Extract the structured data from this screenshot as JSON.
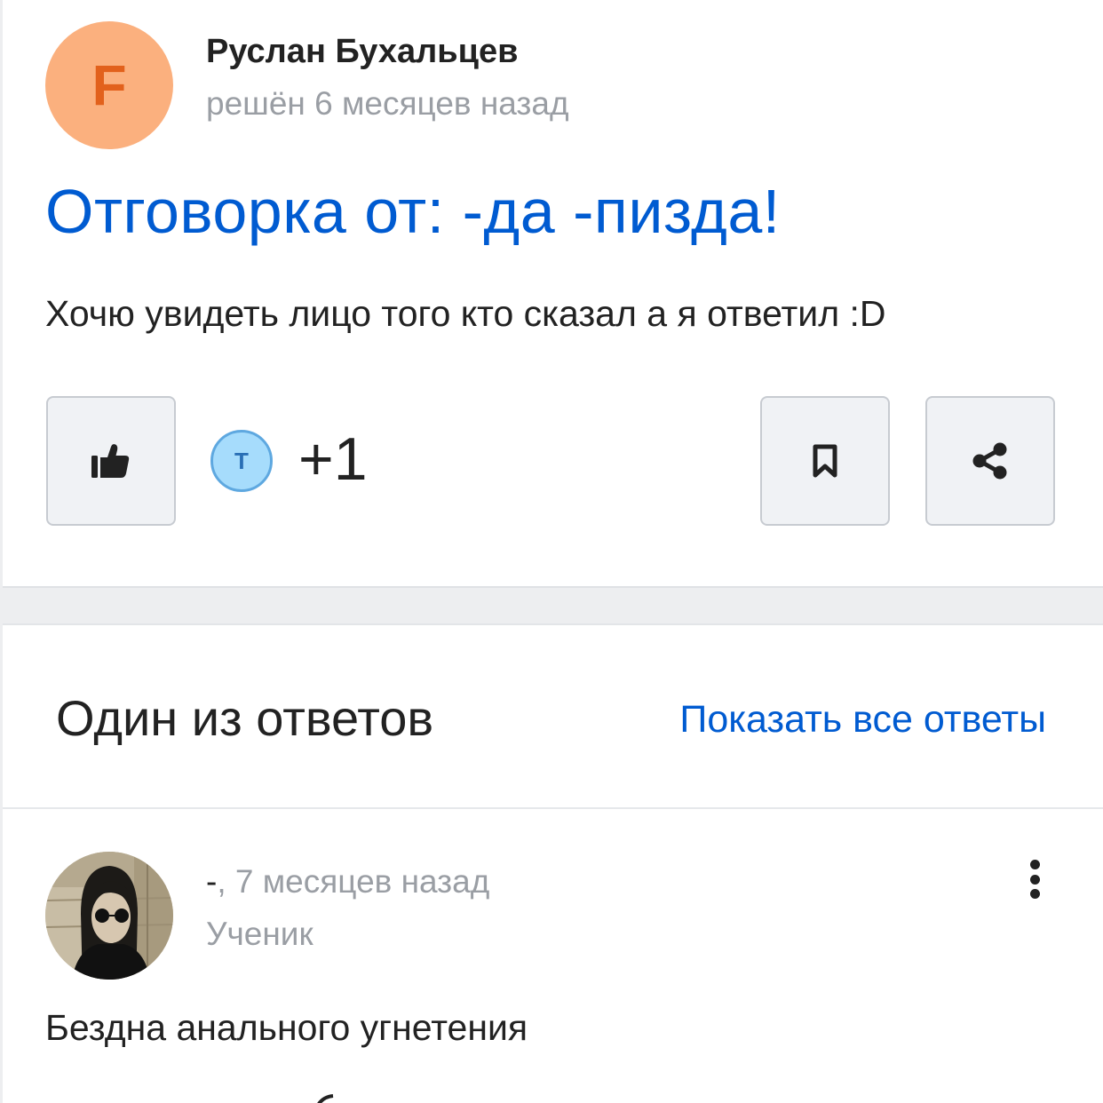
{
  "question": {
    "author": {
      "name": "Руслан Бухальцев",
      "avatar_letter": "F",
      "avatar_color": "#fbb07e",
      "avatar_letter_color": "#e2611c"
    },
    "status_time": "решён 6 месяцев назад",
    "title": "Отговорка от: -да -пизда!",
    "body": "Хочю увидеть лицо того кто сказал а я ответил :D",
    "actions": {
      "like_icon": "thumbs-up-icon",
      "liker_avatar_letter": "T",
      "like_count": "+1",
      "bookmark_icon": "bookmark-icon",
      "share_icon": "share-icon"
    }
  },
  "answers_section": {
    "title": "Один из ответов",
    "show_all_label": "Показать все ответы",
    "answer": {
      "author_name": "-",
      "time": ", 7 месяцев назад",
      "rank": "Ученик",
      "text": "Бездна анального угнетения",
      "more_icon": "more-vertical-icon"
    }
  },
  "colors": {
    "link_blue": "#005bd1",
    "text_dark": "#222222",
    "text_muted": "#9a9ea4",
    "page_bg": "#edeef0",
    "button_bg": "#f0f2f5"
  }
}
